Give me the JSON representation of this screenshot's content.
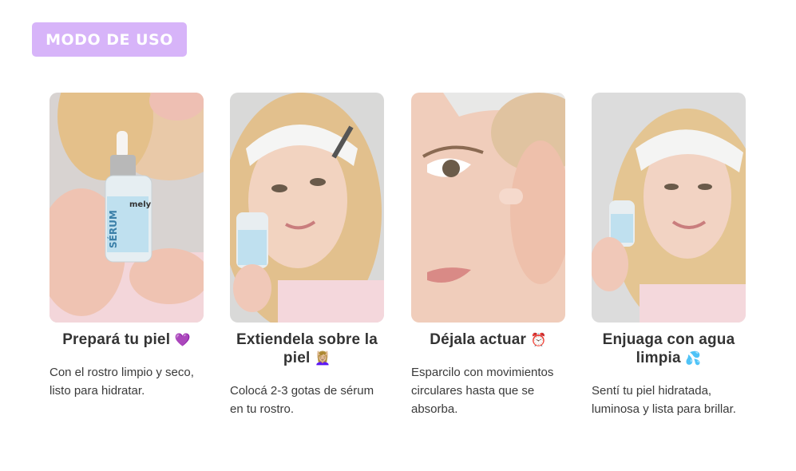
{
  "header": {
    "badge_label": "MODO DE USO",
    "badge_color": "#d7b4f9"
  },
  "product": {
    "brand": "mely",
    "label": "SÉRUM"
  },
  "steps": [
    {
      "title": "Prepará tu piel",
      "emoji": "💜",
      "description": "Con el rostro limpio y seco, listo para hidratar."
    },
    {
      "title": "Extiendela sobre la piel",
      "emoji": "💆🏼‍♀️",
      "description": "Colocá 2-3 gotas de sérum en tu rostro."
    },
    {
      "title": "Déjala actuar",
      "emoji": "⏰",
      "description": "Esparcilo con movimientos circulares hasta que se absorba."
    },
    {
      "title": "Enjuaga con agua limpia",
      "emoji": "💦",
      "description": "Sentí tu piel hidratada, luminosa y lista para brillar."
    }
  ]
}
